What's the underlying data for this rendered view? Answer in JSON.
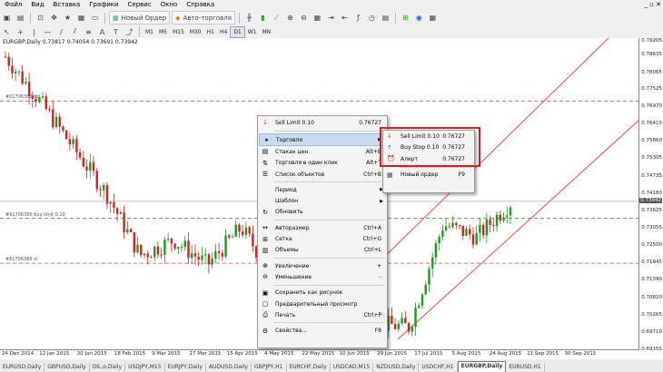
{
  "menu": [
    "Файл",
    "Вид",
    "Вставка",
    "Графики",
    "Сервис",
    "Окно",
    "Справка"
  ],
  "window_controls": "_ ▫ ✕",
  "toolbar": {
    "new_order": "Новый Ордер",
    "autotrade": "Авто-торговля",
    "timeframes": [
      "M1",
      "M5",
      "M15",
      "M30",
      "H1",
      "H4",
      "D1",
      "W1",
      "MN"
    ],
    "active_timeframe": "D1"
  },
  "chart": {
    "title": "EURGBP,Daily  0.73817 0.74054 0.73691 0.73942",
    "price_labels": [
      "0.79205",
      "0.78635",
      "0.78065",
      "0.77525",
      "0.76970",
      "0.76415",
      "0.75860",
      "0.75305",
      "0.74735",
      "0.74180",
      "0.73942",
      "0.73625",
      "0.73055",
      "0.72500",
      "0.71945",
      "0.71390",
      "0.70820",
      "0.70265",
      "0.69710",
      "0.69155"
    ],
    "current_price": "0.73942",
    "date_labels": [
      "24 Dec 2014",
      "12 Jan 2015",
      "30 Jan 2015",
      "18 Feb 2015",
      "9 Mar 2015",
      "27 Mar 2015",
      "15 Apr 2015",
      "4 May 2015",
      "22 May 2015",
      "10 Jun 2015",
      "29 Jun 2015",
      "17 Jul 2015",
      "5 Aug 2015",
      "24 Aug 2015",
      "11 Sep 2015",
      "30 Sep 2015"
    ],
    "hlines": [
      {
        "label": "#61706386 tp",
        "price": 0.7717,
        "color": "#e23b3b"
      },
      {
        "label": "#61706386 buy limit 0.10",
        "price": 0.734,
        "color": "#2e8b2e"
      },
      {
        "label": "#61706386 sl",
        "price": 0.7195,
        "color": "#e23b3b"
      }
    ]
  },
  "context_menu": {
    "sell_limit": {
      "label": "Sell Limit 0.10",
      "price": "0.76727"
    },
    "items": [
      {
        "name": "trade",
        "icon": "▸",
        "label": "Торговля",
        "shortcut": "",
        "arrow": true,
        "hl": true
      },
      {
        "name": "depth",
        "icon": "▤",
        "label": "Стакан цен",
        "shortcut": "Alt+B"
      },
      {
        "name": "oneclick",
        "icon": "⇅",
        "label": "Торговля в один клик",
        "shortcut": "Alt+T"
      },
      {
        "name": "objects",
        "icon": "☰",
        "label": "Список объектов",
        "shortcut": "Ctrl+B"
      },
      {
        "sep": true
      },
      {
        "name": "period",
        "icon": "",
        "label": "Период",
        "shortcut": "",
        "arrow": true
      },
      {
        "name": "template",
        "icon": "",
        "label": "Шаблон",
        "shortcut": "",
        "arrow": true
      },
      {
        "name": "refresh",
        "icon": "↻",
        "label": "Обновить",
        "shortcut": ""
      },
      {
        "sep": true
      },
      {
        "name": "autoscroll",
        "icon": "↔",
        "label": "Авторазмер",
        "shortcut": "Ctrl+A"
      },
      {
        "name": "grid",
        "icon": "⊞",
        "label": "Сетка",
        "shortcut": "Ctrl+G"
      },
      {
        "name": "volumes",
        "icon": "▥",
        "label": "Объемы",
        "shortcut": "Ctrl+L"
      },
      {
        "sep": true
      },
      {
        "name": "zoomin",
        "icon": "⊕",
        "label": "Увеличение",
        "shortcut": "+"
      },
      {
        "name": "zoomout",
        "icon": "⊖",
        "label": "Уменьшение",
        "shortcut": "-"
      },
      {
        "sep": true
      },
      {
        "name": "save",
        "icon": "▣",
        "label": "Сохранить как рисунок",
        "shortcut": ""
      },
      {
        "name": "preview",
        "icon": "▢",
        "label": "Предварительный просмотр",
        "shortcut": ""
      },
      {
        "name": "print",
        "icon": "⎙",
        "label": "Печать",
        "shortcut": "Ctrl+P"
      },
      {
        "sep": true
      },
      {
        "name": "props",
        "icon": "⚙",
        "label": "Свойства...",
        "shortcut": "F8"
      }
    ]
  },
  "submenu": {
    "items": [
      {
        "name": "sell-limit",
        "icon": "↓",
        "icon_color": "#d33",
        "label": "Sell Limit 0.10",
        "price": "0.76727"
      },
      {
        "name": "buy-stop",
        "icon": "↑",
        "icon_color": "#2266cc",
        "label": "Buy Stop 0.10",
        "price": "0.76727"
      },
      {
        "name": "alert",
        "icon": "⏰",
        "icon_color": "#2a8a2a",
        "label": "Алерт",
        "price": "0.76727"
      },
      {
        "sep": true
      },
      {
        "name": "new-order",
        "icon": "▦",
        "icon_color": "#444",
        "label": "Новый ордер",
        "price": "F9"
      }
    ]
  },
  "tabs": [
    "EURUSD,Daily",
    "GBPUSD,Daily",
    "OIL,o,Daily",
    "USDJPY,M15",
    "EURJPY,Daily",
    "AUDUSD,Daily",
    "GBPJPY,H1",
    "EURCHF,Daily",
    "USDCAD,M15",
    "NZDUSD,Daily",
    "USDCHF,H1",
    "EURGBP,Daily",
    "EURUSD,H1"
  ],
  "active_tab": "EURGBP,Daily",
  "chart_data": {
    "type": "line",
    "x": [
      "24 Dec 2014",
      "12 Jan 2015",
      "30 Jan 2015",
      "18 Feb 2015",
      "9 Mar 2015",
      "27 Mar 2015",
      "15 Apr 2015",
      "4 May 2015",
      "22 May 2015",
      "10 Jun 2015",
      "29 Jun 2015",
      "17 Jul 2015",
      "5 Aug 2015",
      "24 Aug 2015",
      "11 Sep 2015",
      "30 Sep 2015"
    ],
    "series": [
      {
        "name": "EURGBP,Daily",
        "values": [
          0.786,
          0.772,
          0.757,
          0.742,
          0.722,
          0.727,
          0.719,
          0.731,
          0.715,
          0.718,
          0.707,
          0.7,
          0.699,
          0.732,
          0.728,
          0.739
        ]
      }
    ],
    "ylim": [
      0.6915,
      0.792
    ]
  }
}
